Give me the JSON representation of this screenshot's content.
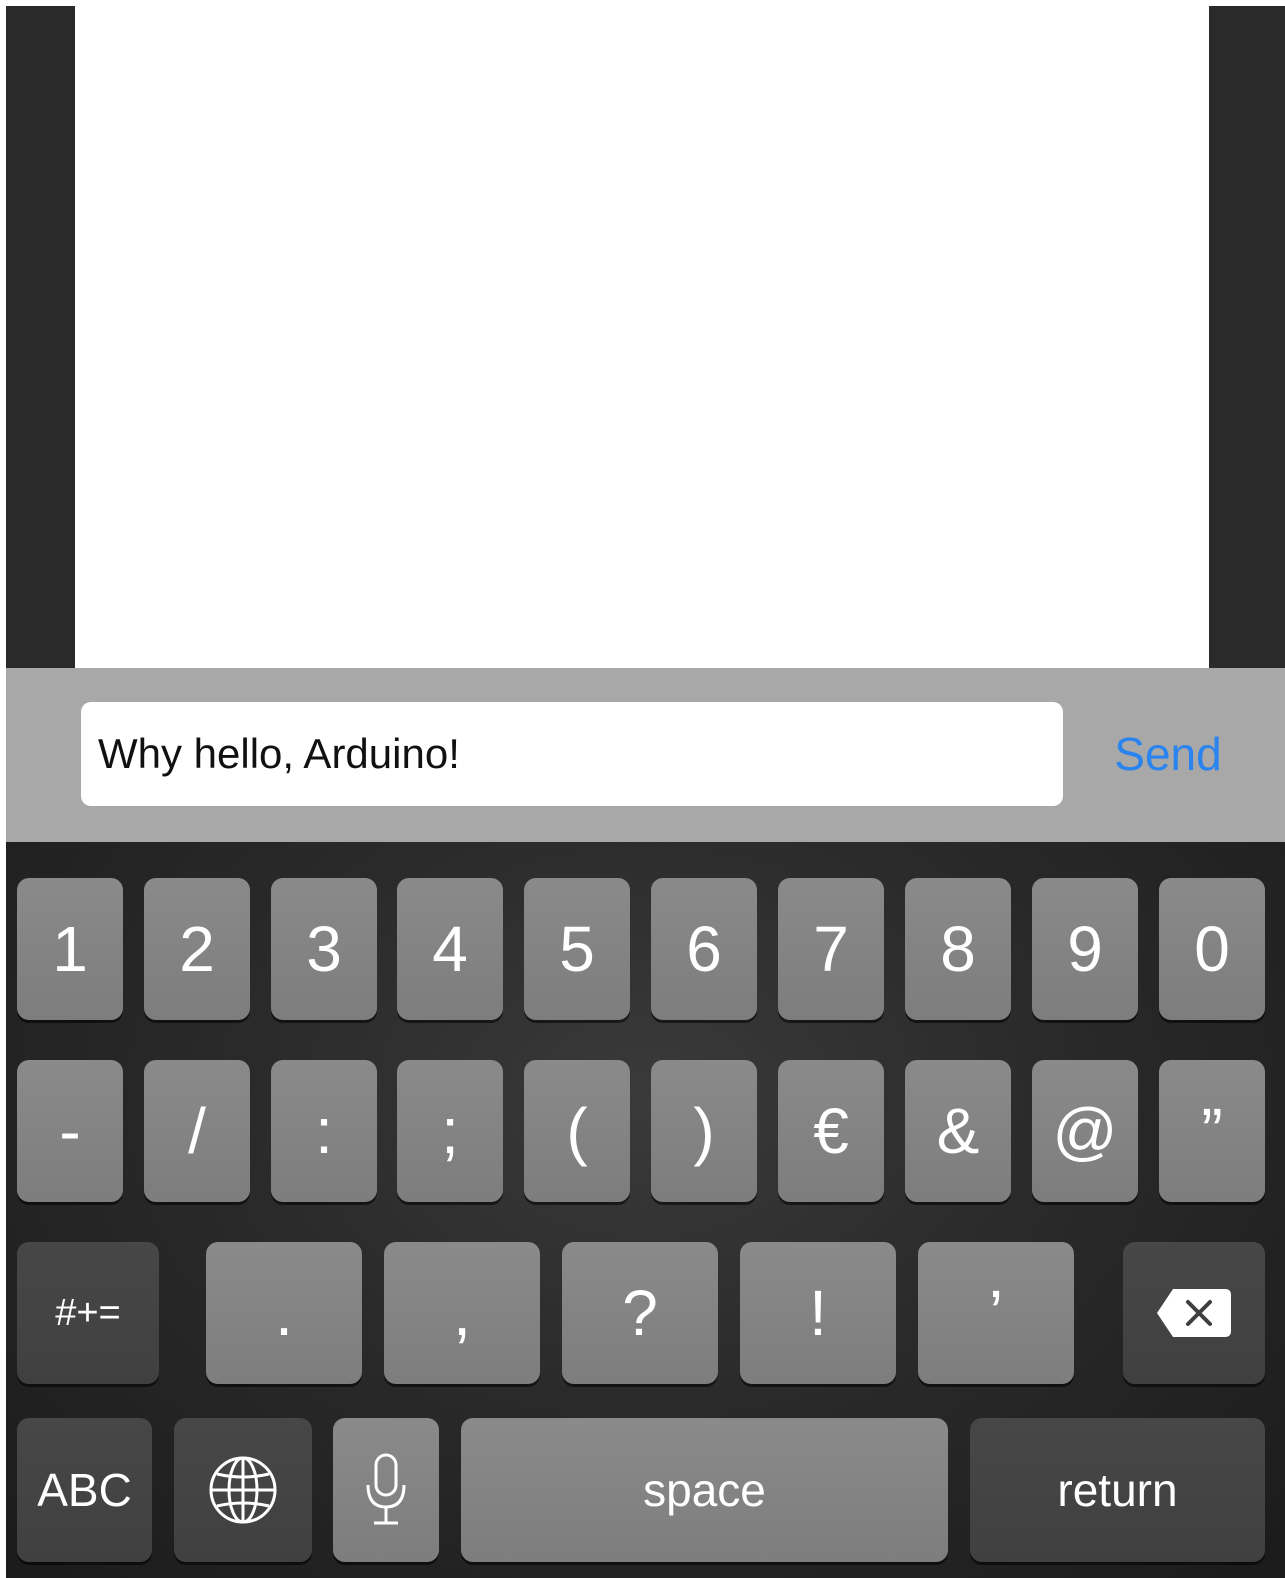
{
  "composer": {
    "message_value": "Why hello, Arduino!",
    "send_label": "Send",
    "send_color": "#2a84f0"
  },
  "keyboard": {
    "row1": [
      "1",
      "2",
      "3",
      "4",
      "5",
      "6",
      "7",
      "8",
      "9",
      "0"
    ],
    "row2": [
      "-",
      "/",
      ":",
      ";",
      "(",
      ")",
      "€",
      "&",
      "@",
      "”"
    ],
    "row3": {
      "symbols_toggle": "#+=",
      "keys": [
        ".",
        ",",
        "?",
        "!",
        "’"
      ],
      "delete_icon": "delete-backspace-icon"
    },
    "row4": {
      "abc": "ABC",
      "globe_icon": "globe-icon",
      "mic_icon": "microphone-icon",
      "space": "space",
      "return": "return"
    }
  }
}
